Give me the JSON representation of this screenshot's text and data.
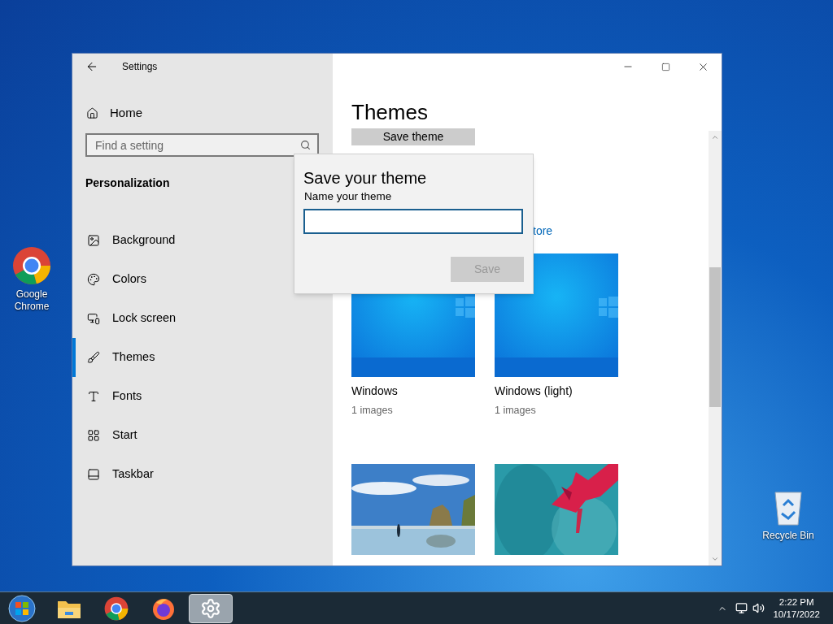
{
  "desktop_icons": [
    {
      "label": "Google Chrome",
      "kind": "chrome"
    },
    {
      "label": "Recycle Bin",
      "kind": "recycle"
    }
  ],
  "window": {
    "title": "Settings"
  },
  "sidebar": {
    "home": "Home",
    "search": {
      "placeholder": "Find a setting"
    },
    "section": "Personalization",
    "items": [
      {
        "label": "Background",
        "kind": "background",
        "selected": false
      },
      {
        "label": "Colors",
        "kind": "colors",
        "selected": false
      },
      {
        "label": "Lock screen",
        "kind": "lock",
        "selected": false
      },
      {
        "label": "Themes",
        "kind": "themes",
        "selected": true
      },
      {
        "label": "Fonts",
        "kind": "fonts",
        "selected": false
      },
      {
        "label": "Start",
        "kind": "start",
        "selected": false
      },
      {
        "label": "Taskbar",
        "kind": "taskbar",
        "selected": false
      }
    ]
  },
  "content": {
    "title": "Themes",
    "save_button": "Save theme",
    "link": "tore",
    "themes": [
      {
        "name": "Windows",
        "count": "1 images",
        "kind": "blue"
      },
      {
        "name": "Windows (light)",
        "count": "1 images",
        "kind": "blue"
      },
      {
        "kind": "beach"
      },
      {
        "kind": "flower"
      }
    ]
  },
  "dialog": {
    "title": "Save your theme",
    "label": "Name your theme",
    "button": {
      "label": "Save",
      "disabled": true
    }
  },
  "taskbar": {
    "apps": [
      {
        "kind": "explorer",
        "selected": false
      },
      {
        "kind": "chrome",
        "selected": false
      },
      {
        "kind": "firefox",
        "selected": false
      },
      {
        "kind": "settings",
        "selected": true
      }
    ],
    "time": "2:22 PM",
    "date": "10/17/2022"
  }
}
